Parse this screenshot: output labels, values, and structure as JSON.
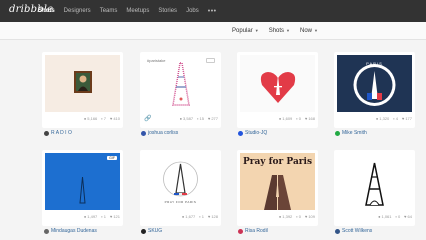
{
  "header": {
    "logo": "dribbble",
    "nav": [
      "Shots",
      "Designers",
      "Teams",
      "Meetups",
      "Stories",
      "Jobs"
    ],
    "more": "•••"
  },
  "filters": [
    {
      "label": "Popular"
    },
    {
      "label": "Shots"
    },
    {
      "label": "Now"
    }
  ],
  "shots": [
    {
      "views": "5,166",
      "comments": "7",
      "likes": "410",
      "author": "R A D I O",
      "avatar_color": "#444444"
    },
    {
      "views": "3,587",
      "comments": "15",
      "likes": "277",
      "author": "joshua corliss",
      "avatar_color": "#3355aa",
      "tag": "#paristake"
    },
    {
      "views": "1,609",
      "comments": "0",
      "likes": "168",
      "author": "Studio-JQ",
      "avatar_color": "#2255dd"
    },
    {
      "views": "1,320",
      "comments": "4",
      "likes": "177",
      "author": "Mike Smith",
      "avatar_color": "#22aa44",
      "caption": "PARIS"
    },
    {
      "views": "1,497",
      "comments": "1",
      "likes": "121",
      "author": "Mindaugas Dudenas",
      "avatar_color": "#666666",
      "badge": "GIF"
    },
    {
      "views": "1,677",
      "comments": "1",
      "likes": "128",
      "author": "SKUG",
      "avatar_color": "#222222",
      "caption": "PRAY FOR PARIS"
    },
    {
      "views": "1,392",
      "comments": "0",
      "likes": "109",
      "author": "Risa Rodil",
      "avatar_color": "#cc3355",
      "caption": "Pray for Paris"
    },
    {
      "views": "1,061",
      "comments": "0",
      "likes": "64",
      "author": "Scott Wilkens",
      "avatar_color": "#335588"
    }
  ]
}
